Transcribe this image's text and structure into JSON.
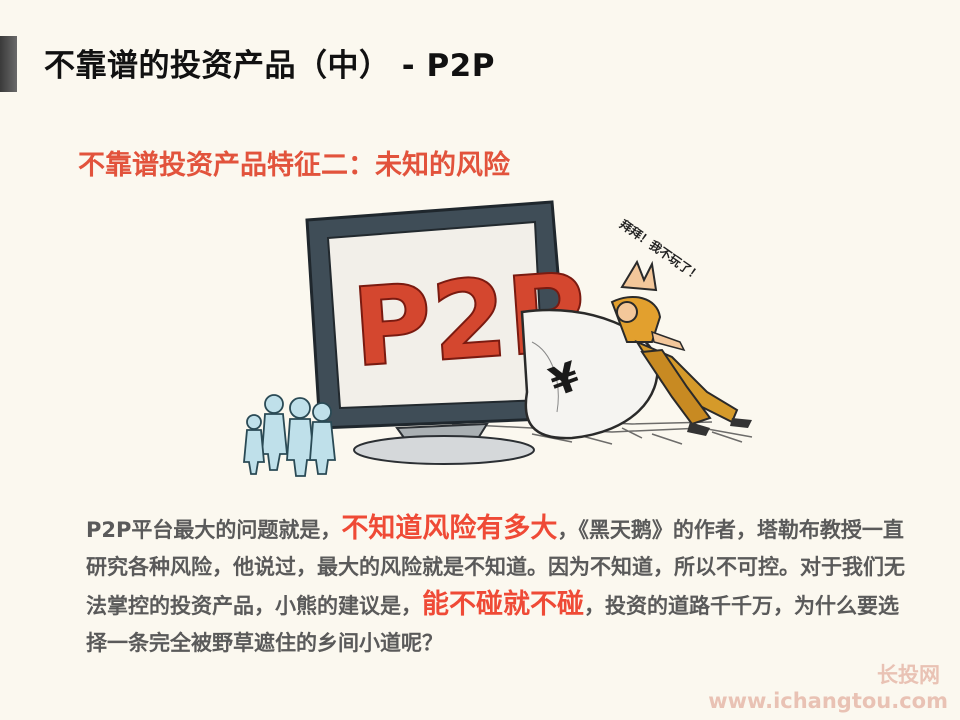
{
  "title": "不靠谱的投资产品（中） - P2P",
  "subtitle": "不靠谱投资产品特征二：未知的风险",
  "illustration": {
    "monitor_text": "P2P",
    "bag_symbol": "¥",
    "speech": "拜拜！我不玩了！"
  },
  "body": {
    "p1": "P2P平台最大的问题就是，",
    "h1": "不知道风险有多大",
    "p2": "，《黑天鹅》的作者，塔勒布教授一直研究各种风险，他说过，最大的风险就是不知道。因为不知道，所以不可控。对于我们无法掌控的投资产品，小熊的建议是，",
    "h2": "能不碰就不碰",
    "p3": "，投资的道路千千万，为什么要选择一条完全被野草遮住的乡间小道呢？"
  },
  "watermark": {
    "name": "长投网",
    "url": "www.ichangtou.com"
  },
  "colors": {
    "title": "#111111",
    "accent": "#e2533c",
    "highlight": "#ef4a36",
    "body": "#5a5a5a",
    "background": "#fbf8ef"
  }
}
